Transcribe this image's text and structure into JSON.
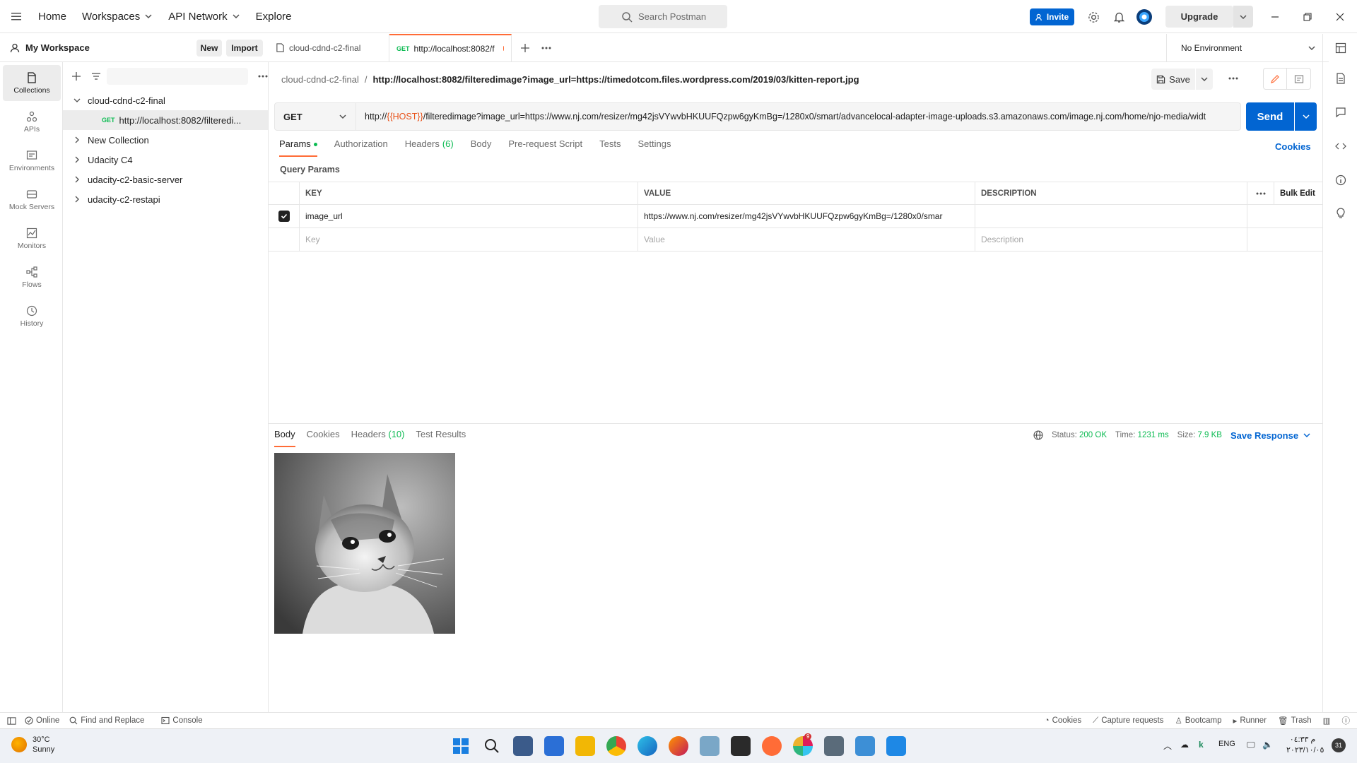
{
  "topnav": {
    "items": [
      "Home",
      "Workspaces",
      "API Network",
      "Explore"
    ],
    "search_placeholder": "Search Postman",
    "invite_label": "Invite",
    "upgrade_label": "Upgrade"
  },
  "workspace": {
    "title": "My Workspace",
    "new_label": "New",
    "import_label": "Import"
  },
  "rail": [
    {
      "label": "Collections",
      "icon": "collections-icon"
    },
    {
      "label": "APIs",
      "icon": "apis-icon"
    },
    {
      "label": "Environments",
      "icon": "environments-icon"
    },
    {
      "label": "Mock Servers",
      "icon": "mock-servers-icon"
    },
    {
      "label": "Monitors",
      "icon": "monitors-icon"
    },
    {
      "label": "Flows",
      "icon": "flows-icon"
    },
    {
      "label": "History",
      "icon": "history-icon"
    }
  ],
  "tree": {
    "collections": [
      {
        "name": "cloud-cdnd-c2-final",
        "expanded": true
      },
      {
        "name": "New Collection",
        "expanded": false
      },
      {
        "name": "Udacity C4",
        "expanded": false
      },
      {
        "name": "udacity-c2-basic-server",
        "expanded": false
      },
      {
        "name": "udacity-c2-restapi",
        "expanded": false
      }
    ],
    "request": {
      "method": "GET",
      "name": "http://localhost:8082/filteredi..."
    }
  },
  "tabs": [
    {
      "label": "cloud-cdnd-c2-final",
      "method": ""
    },
    {
      "label": "http://localhost:8082/f",
      "method": "GET"
    }
  ],
  "environment": "No Environment",
  "breadcrumb": {
    "parent": "cloud-cdnd-c2-final",
    "separator": "/",
    "current": "http://localhost:8082/filteredimage?image_url=https://timedotcom.files.wordpress.com/2019/03/kitten-report.jpg"
  },
  "save_label": "Save",
  "request": {
    "method": "GET",
    "url_prefix": "http://",
    "url_var": "{{HOST}}",
    "url_rest": "/filteredimage?image_url=https://www.nj.com/resizer/mg42jsVYwvbHKUUFQzpw6gyKmBg=/1280x0/smart/advancelocal-adapter-image-uploads.s3.amazonaws.com/image.nj.com/home/njo-media/widt",
    "send_label": "Send"
  },
  "req_tabs": {
    "params": "Params",
    "authorization": "Authorization",
    "headers": "Headers",
    "headers_count": "(6)",
    "body": "Body",
    "prerequest": "Pre-request Script",
    "tests": "Tests",
    "settings": "Settings",
    "cookies": "Cookies"
  },
  "query_params": {
    "title": "Query Params",
    "headers": {
      "key": "KEY",
      "value": "VALUE",
      "description": "DESCRIPTION",
      "bulk_edit": "Bulk Edit"
    },
    "rows": [
      {
        "checked": true,
        "key": "image_url",
        "value": "https://www.nj.com/resizer/mg42jsVYwvbHKUUFQzpw6gyKmBg=/1280x0/smar",
        "description": ""
      }
    ],
    "placeholders": {
      "key": "Key",
      "value": "Value",
      "description": "Description"
    }
  },
  "response": {
    "tabs": {
      "body": "Body",
      "cookies": "Cookies",
      "headers": "Headers",
      "headers_count": "(10)",
      "test_results": "Test Results"
    },
    "status_label": "Status:",
    "status": "200 OK",
    "time_label": "Time:",
    "time": "1231 ms",
    "size_label": "Size:",
    "size": "7.9 KB",
    "save_response": "Save Response"
  },
  "statusbar": {
    "online": "Online",
    "find_replace": "Find and Replace",
    "console": "Console",
    "cookies": "Cookies",
    "capture": "Capture requests",
    "bootcamp": "Bootcamp",
    "runner": "Runner",
    "trash": "Trash"
  },
  "taskbar": {
    "temp": "30°C",
    "weather": "Sunny",
    "lang": "ENG",
    "time": "م ٠٤:٣٣",
    "date": "٢٠٢٣/١٠/٠٥",
    "notifications": "31",
    "badge": "9"
  },
  "colors": {
    "accent": "#ff6c37",
    "primary": "#0265d2",
    "success": "#0cbb52"
  }
}
